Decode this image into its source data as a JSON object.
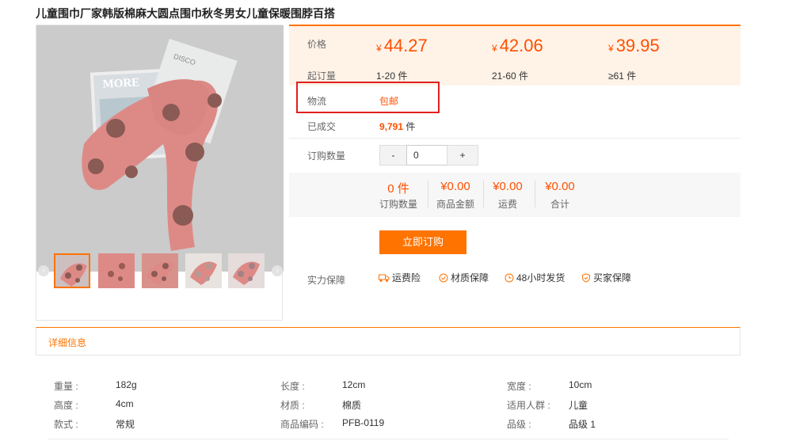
{
  "product": {
    "title": "儿童围巾厂家韩版棉麻大圆点围巾秋冬男女儿童保暖围脖百搭"
  },
  "gallery": {
    "prev": "‹",
    "next": "›",
    "thumb_count": 5,
    "active_thumb": 0
  },
  "price_section": {
    "price_label": "价格",
    "currency": "¥",
    "tiers": [
      {
        "price": "44.27",
        "range": "1-20 件"
      },
      {
        "price": "42.06",
        "range": "21-60 件"
      },
      {
        "price": "39.95",
        "range": "≥61 件"
      }
    ],
    "moq_label": "起订量"
  },
  "logistics": {
    "label": "物流",
    "value": "包邮"
  },
  "sold": {
    "label": "已成交",
    "count": "9,791",
    "unit": "件"
  },
  "order_qty": {
    "label": "订购数量",
    "minus": "-",
    "value": "0",
    "plus": "+"
  },
  "summary": [
    {
      "value": "0 件",
      "label": "订购数量"
    },
    {
      "value": "¥0.00",
      "label": "商品金额"
    },
    {
      "value": "¥0.00",
      "label": "运费"
    },
    {
      "value": "¥0.00",
      "label": "合计"
    }
  ],
  "buy_button": "立即订购",
  "guarantee": {
    "label": "实力保障",
    "items": [
      {
        "icon": "truck-icon",
        "text": "运费险"
      },
      {
        "icon": "check-circle-icon",
        "text": "材质保障"
      },
      {
        "icon": "clock-icon",
        "text": "48小时发货"
      },
      {
        "icon": "shield-icon",
        "text": "买家保障"
      }
    ]
  },
  "details": {
    "tab": "详细信息",
    "rows": [
      [
        {
          "label": "重量 :",
          "value": "182g"
        },
        {
          "label": "长度 :",
          "value": "12cm"
        },
        {
          "label": "宽度 :",
          "value": "10cm"
        }
      ],
      [
        {
          "label": "高度 :",
          "value": "4cm"
        },
        {
          "label": "材质 :",
          "value": "棉质"
        },
        {
          "label": "适用人群 :",
          "value": "儿童"
        }
      ],
      [
        {
          "label": "款式 :",
          "value": "常规"
        },
        {
          "label": "商品编码 :",
          "value": "PFB-0119"
        },
        {
          "label": "品级 :",
          "value": "品级 1"
        }
      ]
    ]
  },
  "colors": {
    "accent": "#ff7300",
    "price": "#ff5000",
    "highlight": "#e02020",
    "scarf": "#dd8a86",
    "dot": "#8a5a55"
  }
}
